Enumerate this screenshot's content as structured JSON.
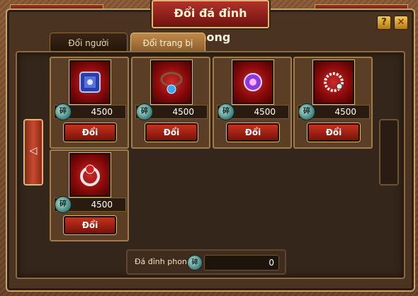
{
  "window": {
    "title": "Đổi đá đỉnh phong"
  },
  "controls": {
    "help_icon": "?",
    "close_icon": "✕",
    "prev_icon": "◁"
  },
  "tabs": [
    {
      "label": "Đổi người",
      "active": false
    },
    {
      "label": "Đổi trang bị",
      "active": true
    }
  ],
  "items": [
    {
      "icon": "armor-icon",
      "price": "4500",
      "button": "Đổi",
      "coin_glyph": "碎"
    },
    {
      "icon": "necklace-icon",
      "price": "4500",
      "button": "Đổi",
      "coin_glyph": "碎"
    },
    {
      "icon": "amulet-icon",
      "price": "4500",
      "button": "Đổi",
      "coin_glyph": "碎"
    },
    {
      "icon": "bracelet-icon",
      "price": "4500",
      "button": "Đổi",
      "coin_glyph": "碎"
    },
    {
      "icon": "ring-icon",
      "price": "4500",
      "button": "Đổi",
      "coin_glyph": "碎"
    }
  ],
  "footer": {
    "label": "Đá đỉnh phong",
    "value": "0",
    "coin_glyph": "碎"
  },
  "colors": {
    "accent_red": "#c6321f",
    "gold_border": "#d9b877",
    "coin_teal": "#4c8a83"
  }
}
